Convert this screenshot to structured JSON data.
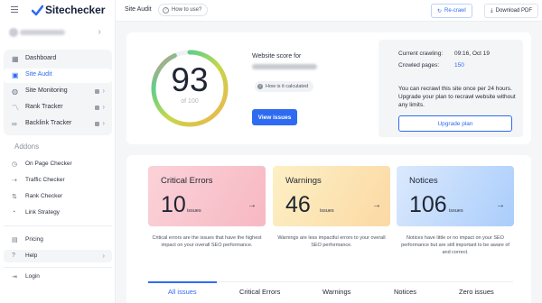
{
  "brand": {
    "name": "Sitechecker",
    "accent": "#2f6bf2"
  },
  "sidebar": {
    "items": [
      {
        "label": "Dashboard",
        "icon": "grid-icon",
        "active": false,
        "locked": false
      },
      {
        "label": "Site Audit",
        "icon": "audit-icon",
        "active": true,
        "locked": false
      },
      {
        "label": "Site Monitoring",
        "icon": "monitor-icon",
        "active": false,
        "locked": true
      },
      {
        "label": "Rank Tracker",
        "icon": "trend-icon",
        "active": false,
        "locked": true
      },
      {
        "label": "Backlink Tracker",
        "icon": "link-icon",
        "active": false,
        "locked": true
      }
    ],
    "addons_title": "Addons",
    "addons": [
      {
        "label": "On Page Checker",
        "icon": "page-icon"
      },
      {
        "label": "Traffic Checker",
        "icon": "traffic-icon"
      },
      {
        "label": "Rank Checker",
        "icon": "rank-icon"
      },
      {
        "label": "Link Strategy",
        "icon": "strategy-icon"
      }
    ],
    "bottom": [
      {
        "label": "Pricing",
        "icon": "pricing-icon"
      },
      {
        "label": "Help",
        "icon": "help-icon"
      },
      {
        "label": "Login",
        "icon": "login-icon"
      }
    ]
  },
  "topbar": {
    "crumb": "Site Audit",
    "how_to": "How to use?",
    "recrawl": "Re-crawl",
    "download": "Download PDF"
  },
  "score": {
    "value": "93",
    "of": "of 100",
    "fraction": 0.93,
    "label": "Website score for",
    "how_calc": "How is it calculated",
    "view_issues": "View issues"
  },
  "crawl": {
    "current_label": "Current crawling:",
    "current_value": "09:16, Oct 19",
    "pages_label": "Crowled pages:",
    "pages_value": "150",
    "notice": "You can recrawl this site once per 24 hours. Upgrade your plan to recrawl website without any limits.",
    "upgrade": "Upgrade plan"
  },
  "issues": [
    {
      "title": "Critical Errors",
      "count": "10",
      "unit": "issues",
      "desc": "Critical errors are the issues that have the highest impact on your overall SEO performance."
    },
    {
      "title": "Warnings",
      "count": "46",
      "unit": "issues",
      "desc": "Warnings are less impactful errors to your overall SEO performance."
    },
    {
      "title": "Notices",
      "count": "106",
      "unit": "issues",
      "desc": "Notices have little or no impact on your SEO performance but are still important to be aware of and correct."
    }
  ],
  "tabs": [
    "All issues",
    "Critical Errors",
    "Warnings",
    "Notices",
    "Zero issues"
  ]
}
